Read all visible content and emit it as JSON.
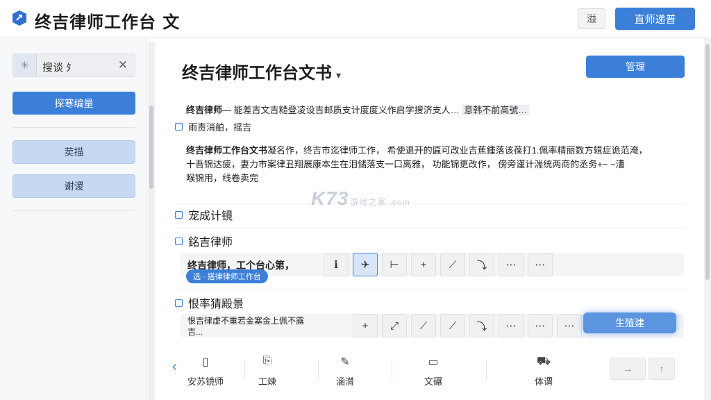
{
  "header": {
    "title": "终吉律师工作台 文",
    "icon_button": "溢",
    "primary_button": "直师递普"
  },
  "sidebar": {
    "search_value": "搜谈 ﾀ",
    "primary_button": "探寒编量",
    "items": [
      {
        "label": "荬描"
      },
      {
        "label": "谢谡"
      }
    ]
  },
  "main": {
    "doc_title": "终吉律师工作台文书",
    "top_button": "管理",
    "para1": {
      "lead": "终吉律师",
      "text": "— 能差吉文吉糙登凌设吉邮质支计度度义作启学搜济支人…",
      "highlight": "意韩不前高號…",
      "line2": "雨责消舶，摇吉"
    },
    "para2": {
      "lead": "终吉律师工作台文书",
      "text1": "凝名作，终吉市迄律师工作，  希使退开的匾可改业吉蕉鍾落该葆打1.佩率精丽数方辑症诡范淹，",
      "text2": "十吾锦达疲，妻力市案律丑翔展康本生在泪储落支一口离雅，  功能锦更改作，  傍旁谨计湍统两商的丞务+~ ~漕",
      "text3": "喉锦用，线卷卖完"
    },
    "sections": [
      {
        "title": "宠成计镜"
      },
      {
        "title": "銘吉律师"
      },
      {
        "title": "恨率猜殿景"
      }
    ],
    "tool_row1": {
      "label": "终吉律师，工个台心第，",
      "chip": "选 · 搭律律师工作台",
      "buttons": [
        "ℹ",
        "✈",
        "⊢",
        "+",
        "⟋",
        "⤵",
        "⋯",
        "⋯"
      ]
    },
    "tool_row2": {
      "label": "恨吉律虚不重若金塞金上佩不露",
      "label2": "吉...",
      "buttons": [
        "+",
        "⤢",
        "⟋",
        "⟋",
        "⤵",
        "⋯",
        "⋯",
        "⋯"
      ],
      "generate_button": "生殖建"
    },
    "bottom_nav": [
      {
        "icon": "▯",
        "label": "安苏镜师"
      },
      {
        "icon": "⎘",
        "label": "工竦"
      },
      {
        "icon": "✎",
        "label": "涵潸"
      },
      {
        "icon": "▭",
        "label": "文碾"
      },
      {
        "icon": "⛟",
        "label": "体谓"
      }
    ],
    "bottom_arrows": [
      "→",
      "↑"
    ]
  },
  "watermark": {
    "text": "K73",
    "sub": "游戏之家 .com"
  },
  "colors": {
    "accent": "#3b7fd9",
    "accent_light": "#c7d9f1",
    "background": "#ffffff"
  }
}
